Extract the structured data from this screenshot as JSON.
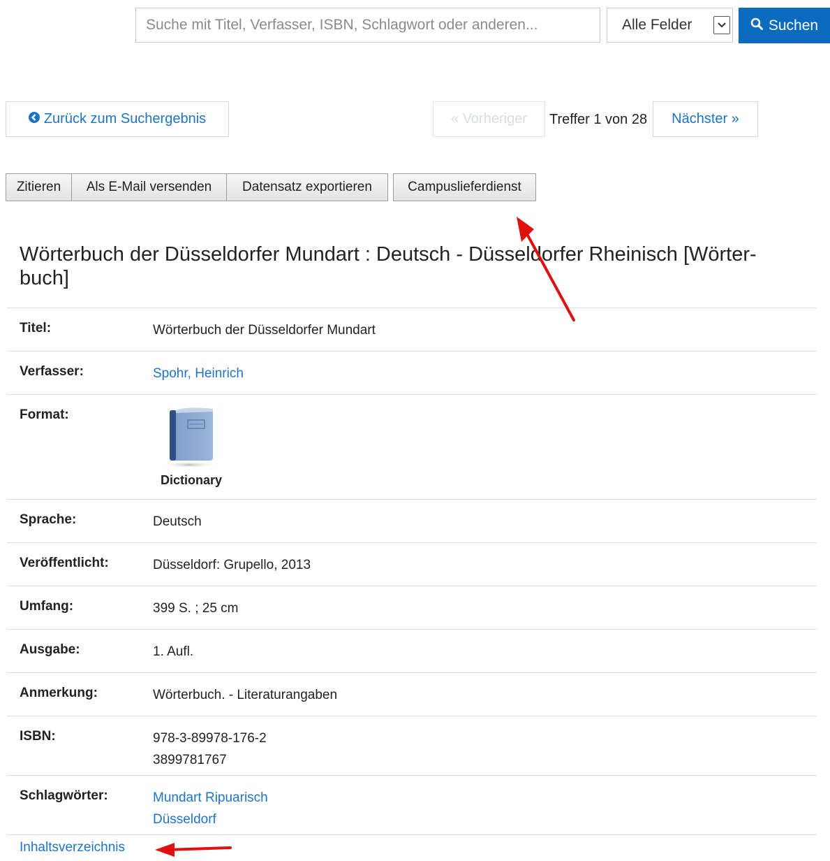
{
  "search": {
    "placeholder": "Suche mit Titel, Verfasser, ISBN, Schlagwort oder anderen...",
    "field_selected": "Alle Felder",
    "button_label": "Suchen"
  },
  "nav": {
    "back_label": "Zurück zum Suchergebnis",
    "prev_label": "« Vorheriger",
    "hits_text": "Treffer 1 von 28",
    "next_label": "Nächster »"
  },
  "toolbar": {
    "cite_label": "Zitieren",
    "email_label": "Als E-Mail versenden",
    "export_label": "Datensatz exportieren",
    "campus_label": "Campuslieferdienst"
  },
  "record": {
    "heading": "Wörterbuch der Düsseldorfer Mundart : Deutsch - Düsseldorfer Rheinisch [Wörter-buch]",
    "fields": {
      "title_label": "Titel:",
      "title_value": "Wörterbuch der Düsseldorfer Mundart",
      "author_label": "Verfasser:",
      "author_value": "Spohr, Heinrich",
      "format_label": "Format:",
      "format_value": "Dictionary",
      "format_icon": "book-icon",
      "language_label": "Sprache:",
      "language_value": "Deutsch",
      "published_label": "Veröffentlicht:",
      "published_value": "Düsseldorf: Grupello, 2013",
      "extent_label": "Umfang:",
      "extent_value": "399 S. ; 25 cm",
      "edition_label": "Ausgabe:",
      "edition_value": "1. Aufl.",
      "note_label": "Anmerkung:",
      "note_value": "Wörterbuch. - Literaturangaben",
      "isbn_label": "ISBN:",
      "isbn_values": [
        "978-3-89978-176-2",
        "3899781767"
      ],
      "subjects_label": "Schlagwörter:",
      "subject_values": [
        "Mundart Ripuarisch",
        "Düsseldorf"
      ]
    },
    "toc_link": "Inhaltsverzeichnis"
  },
  "colors": {
    "primary_button": "#0b6bbf",
    "link": "#1f73c7",
    "annotation_arrow": "#e01010"
  }
}
